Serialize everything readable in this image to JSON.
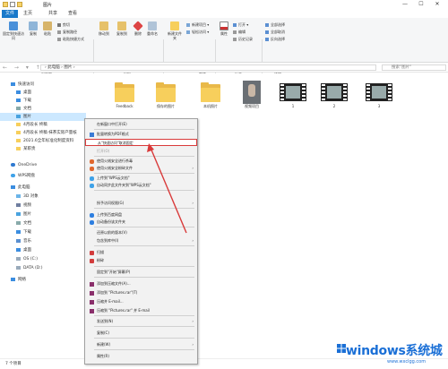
{
  "titlebar": {
    "title": "图片",
    "min": "—",
    "max": "☐",
    "close": "✕"
  },
  "tabs": [
    "文件",
    "主页",
    "共享",
    "查看"
  ],
  "ribbon": {
    "pin_label": "固定到快速访问",
    "copy_label": "复制",
    "paste_label": "粘贴",
    "cut_label": "剪切",
    "copy_path_label": "复制路径",
    "paste_shortcut_label": "粘贴快捷方式",
    "move_to_label": "移动到",
    "copy_to_label": "复制到",
    "delete_label": "删除",
    "rename_label": "重命名",
    "new_folder_label": "新建文件夹",
    "new_item_label": "新建项目 ▾",
    "easy_access_label": "轻松访问 ▾",
    "properties_label": "属性",
    "open_label": "打开 ▾",
    "edit_label": "编辑",
    "history_label": "历史记录",
    "select_all_label": "全部选择",
    "select_none_label": "全部取消",
    "invert_label": "反向选择",
    "groups": [
      "剪贴板",
      "组织",
      "新建",
      "打开",
      "选择"
    ]
  },
  "address": {
    "nav": "← → ▾ ↑",
    "path": "› 此电脑 › 图片 ›",
    "search_placeholder": "搜索\"图片\""
  },
  "nav": {
    "items": [
      "快速访问",
      "桌面",
      "下载",
      "文档",
      "图片",
      "4月段长 终稿",
      "4月段长 终稿·抹茶实际产量核",
      "2021.6全年标准化制度资料",
      "某职责",
      "OneDrive",
      "WPS网盘",
      "此电脑",
      "3D 对象",
      "视频",
      "图片",
      "文档",
      "下载",
      "音乐",
      "桌面",
      "OS (C:)",
      "DATA (D:)",
      "网络"
    ]
  },
  "files": [
    {
      "name": "Feedback",
      "kind": "folder"
    },
    {
      "name": "保存的图片",
      "kind": "folder"
    },
    {
      "name": "本机照片",
      "kind": "folder"
    },
    {
      "name": "视频项目",
      "kind": "photo"
    },
    {
      "name": "1",
      "kind": "video"
    },
    {
      "name": "2",
      "kind": "video"
    },
    {
      "name": "3",
      "kind": "video"
    }
  ],
  "context_menu": {
    "items": [
      "在新窗口中打开(E)",
      "批量转换为PDF格式",
      "从\"快速访问\"取消固定",
      "打开(O)",
      "使用火绒安全进行杀毒",
      "使用火绒安全粉碎文件",
      "上传到\"WPS云文档\"",
      "自动同步此文件夹到\"WPS云文档\"",
      "授予访问权限(G)",
      "上传到百度网盘",
      "自动备份该文件夹",
      "还原以前的版本(V)",
      "包含到库中(I)",
      "扫描",
      "粉碎",
      "固定到\"开始\"屏幕(P)",
      "添加到压缩文件(A)...",
      "添加到 \"Pictures.rar\"(T)",
      "压缩并 E-mail...",
      "压缩到 \"Pictures.rar\" 并 E-mail",
      "发送到(N)",
      "复制(C)",
      "新建(W)",
      "属性(R)"
    ]
  },
  "status": {
    "text": "7 个项目"
  },
  "watermark": {
    "main": "windows系统城",
    "sub": "www.wxclgg.com"
  },
  "colors": {
    "accent": "#1979ca",
    "highlight": "#d93a3a",
    "folder": "#f7cf5c"
  }
}
